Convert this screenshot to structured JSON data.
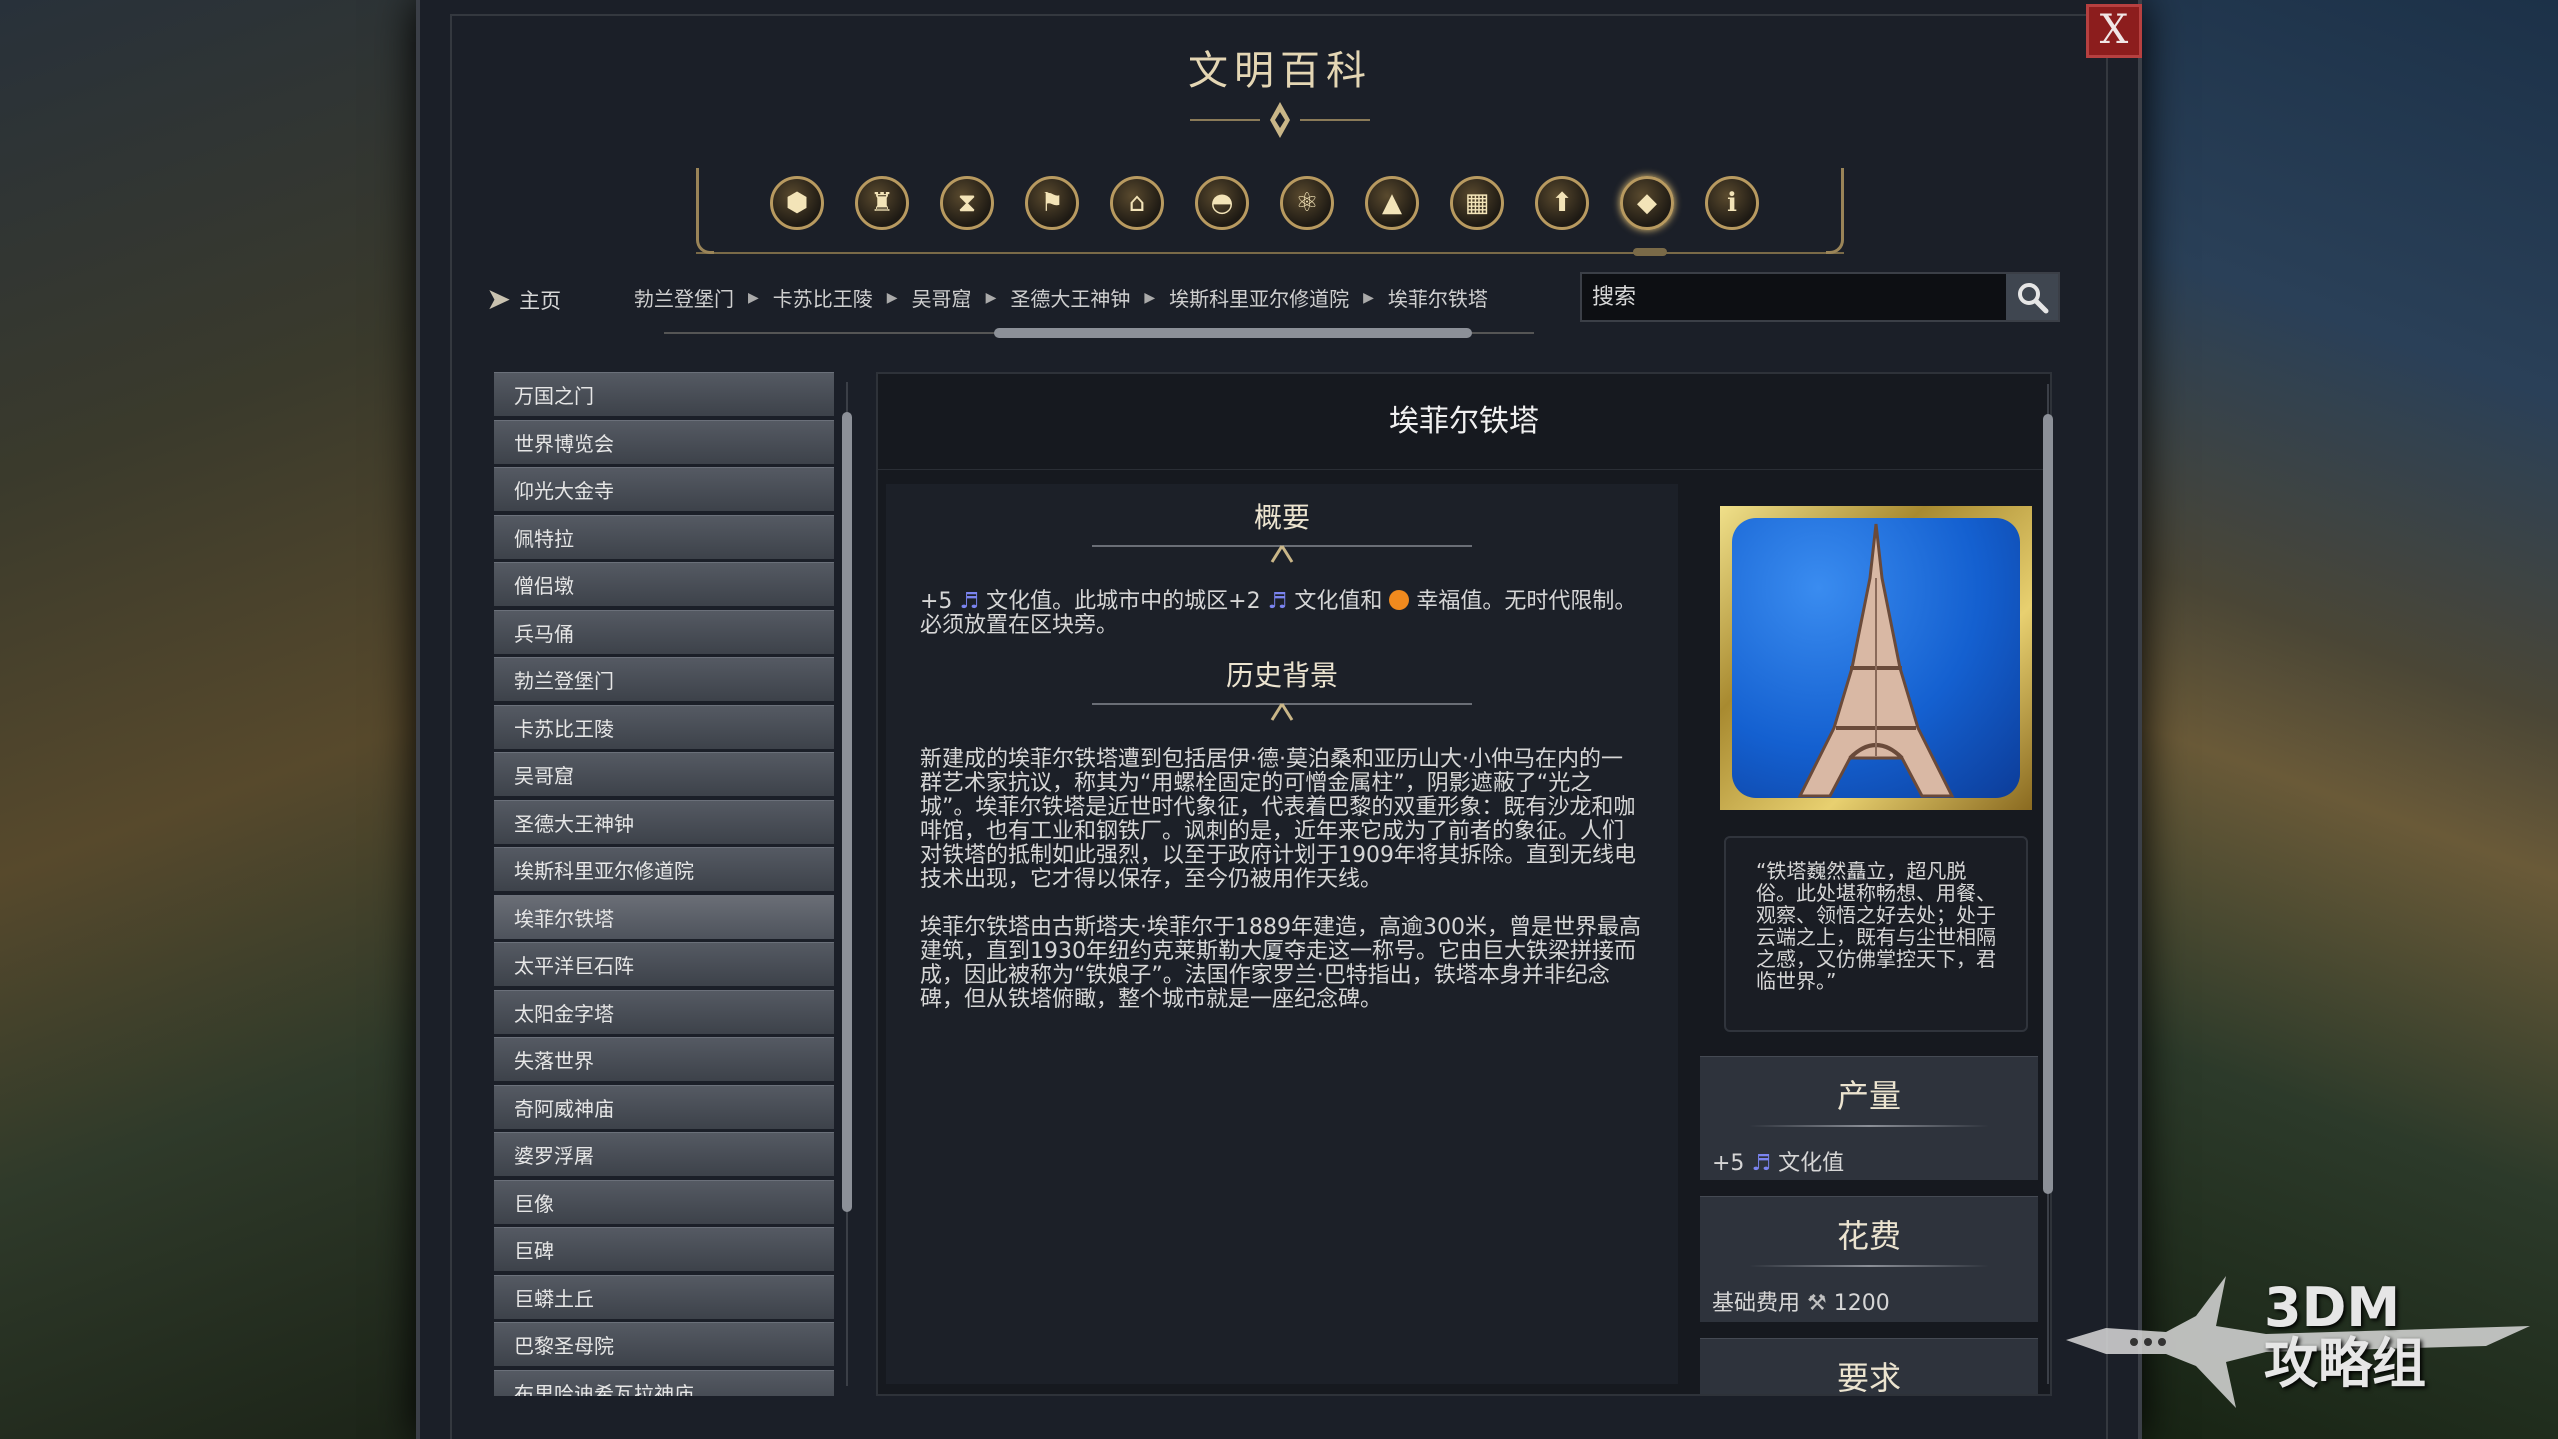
{
  "window": {
    "title": "文明百科",
    "close_label": "X"
  },
  "toolbar": {
    "categories": [
      {
        "name": "resources-icon",
        "glyph": "⬢"
      },
      {
        "name": "goblet-icon",
        "glyph": "♜"
      },
      {
        "name": "hourglass-icon",
        "glyph": "⧗"
      },
      {
        "name": "flag-leader-icon",
        "glyph": "⚑"
      },
      {
        "name": "government-building-icon",
        "glyph": "⌂"
      },
      {
        "name": "dome-icon",
        "glyph": "◓"
      },
      {
        "name": "atom-icon",
        "glyph": "⚛"
      },
      {
        "name": "terrain-icon",
        "glyph": "▲"
      },
      {
        "name": "city-icon",
        "glyph": "▦"
      },
      {
        "name": "upgrade-arrow-icon",
        "glyph": "⬆"
      },
      {
        "name": "wonder-icon",
        "glyph": "◆"
      },
      {
        "name": "info-icon",
        "glyph": "ℹ"
      }
    ],
    "active_index": 10
  },
  "nav": {
    "home_label": "主页",
    "breadcrumbs": [
      "勃兰登堡门",
      "卡苏比王陵",
      "吴哥窟",
      "圣德大王神钟",
      "埃斯科里亚尔修道院",
      "埃菲尔铁塔"
    ]
  },
  "search": {
    "placeholder": "搜索"
  },
  "list": {
    "items": [
      "万国之门",
      "世界博览会",
      "仰光大金寺",
      "佩特拉",
      "僧侣墩",
      "兵马俑",
      "勃兰登堡门",
      "卡苏比王陵",
      "吴哥窟",
      "圣德大王神钟",
      "埃斯科里亚尔修道院",
      "埃菲尔铁塔",
      "太平洋巨石阵",
      "太阳金字塔",
      "失落世界",
      "奇阿威神庙",
      "婆罗浮屠",
      "巨像",
      "巨碑",
      "巨蟒土丘",
      "巴黎圣母院",
      "布里哈迪希瓦拉神庙"
    ],
    "selected_index": 11
  },
  "article": {
    "title": "埃菲尔铁塔",
    "summary_head": "概要",
    "summary": {
      "p1": "+5",
      "p2": "文化值。此城市中的城区+2",
      "p3": "文化值和",
      "p4": "幸福值。无时代限制。必须放置在区块旁。"
    },
    "history_head": "历史背景",
    "history": [
      "新建成的埃菲尔铁塔遭到包括居伊·德·莫泊桑和亚历山大·小仲马在内的一群艺术家抗议，称其为“用螺栓固定的可憎金属柱”，阴影遮蔽了“光之城”。埃菲尔铁塔是近世时代象征，代表着巴黎的双重形象：既有沙龙和咖啡馆，也有工业和钢铁厂。讽刺的是，近年来它成为了前者的象征。人们对铁塔的抵制如此强烈，以至于政府计划于1909年将其拆除。直到无线电技术出现，它才得以保存，至今仍被用作天线。",
      "埃菲尔铁塔由古斯塔夫·埃菲尔于1889年建造，高逾300米，曾是世界最高建筑，直到1930年纽约克莱斯勒大厦夺走这一称号。它由巨大铁梁拼接而成，因此被称为“铁娘子”。法国作家罗兰·巴特指出，铁塔本身并非纪念碑，但从铁塔俯瞰，整个城市就是一座纪念碑。"
    ],
    "quote": "“铁塔巍然矗立，超凡脱俗。此处堪称畅想、用餐、观察、领悟之好去处；处于云端之上，既有与尘世相隔之感，又仿佛掌控天下，君临世界。”"
  },
  "yield": {
    "head": "产量",
    "amount": "+5",
    "label": "文化值"
  },
  "cost": {
    "head": "花费",
    "label": "基础费用",
    "amount": "1200"
  },
  "requirements": {
    "head": "要求"
  },
  "watermark": {
    "line1": "3DM",
    "line2": "攻略组"
  },
  "colors": {
    "accent_gold": "#b89a60",
    "close_red": "#8c1d1d",
    "culture_note": "#7b84f0",
    "happy": "#f08a1e"
  }
}
